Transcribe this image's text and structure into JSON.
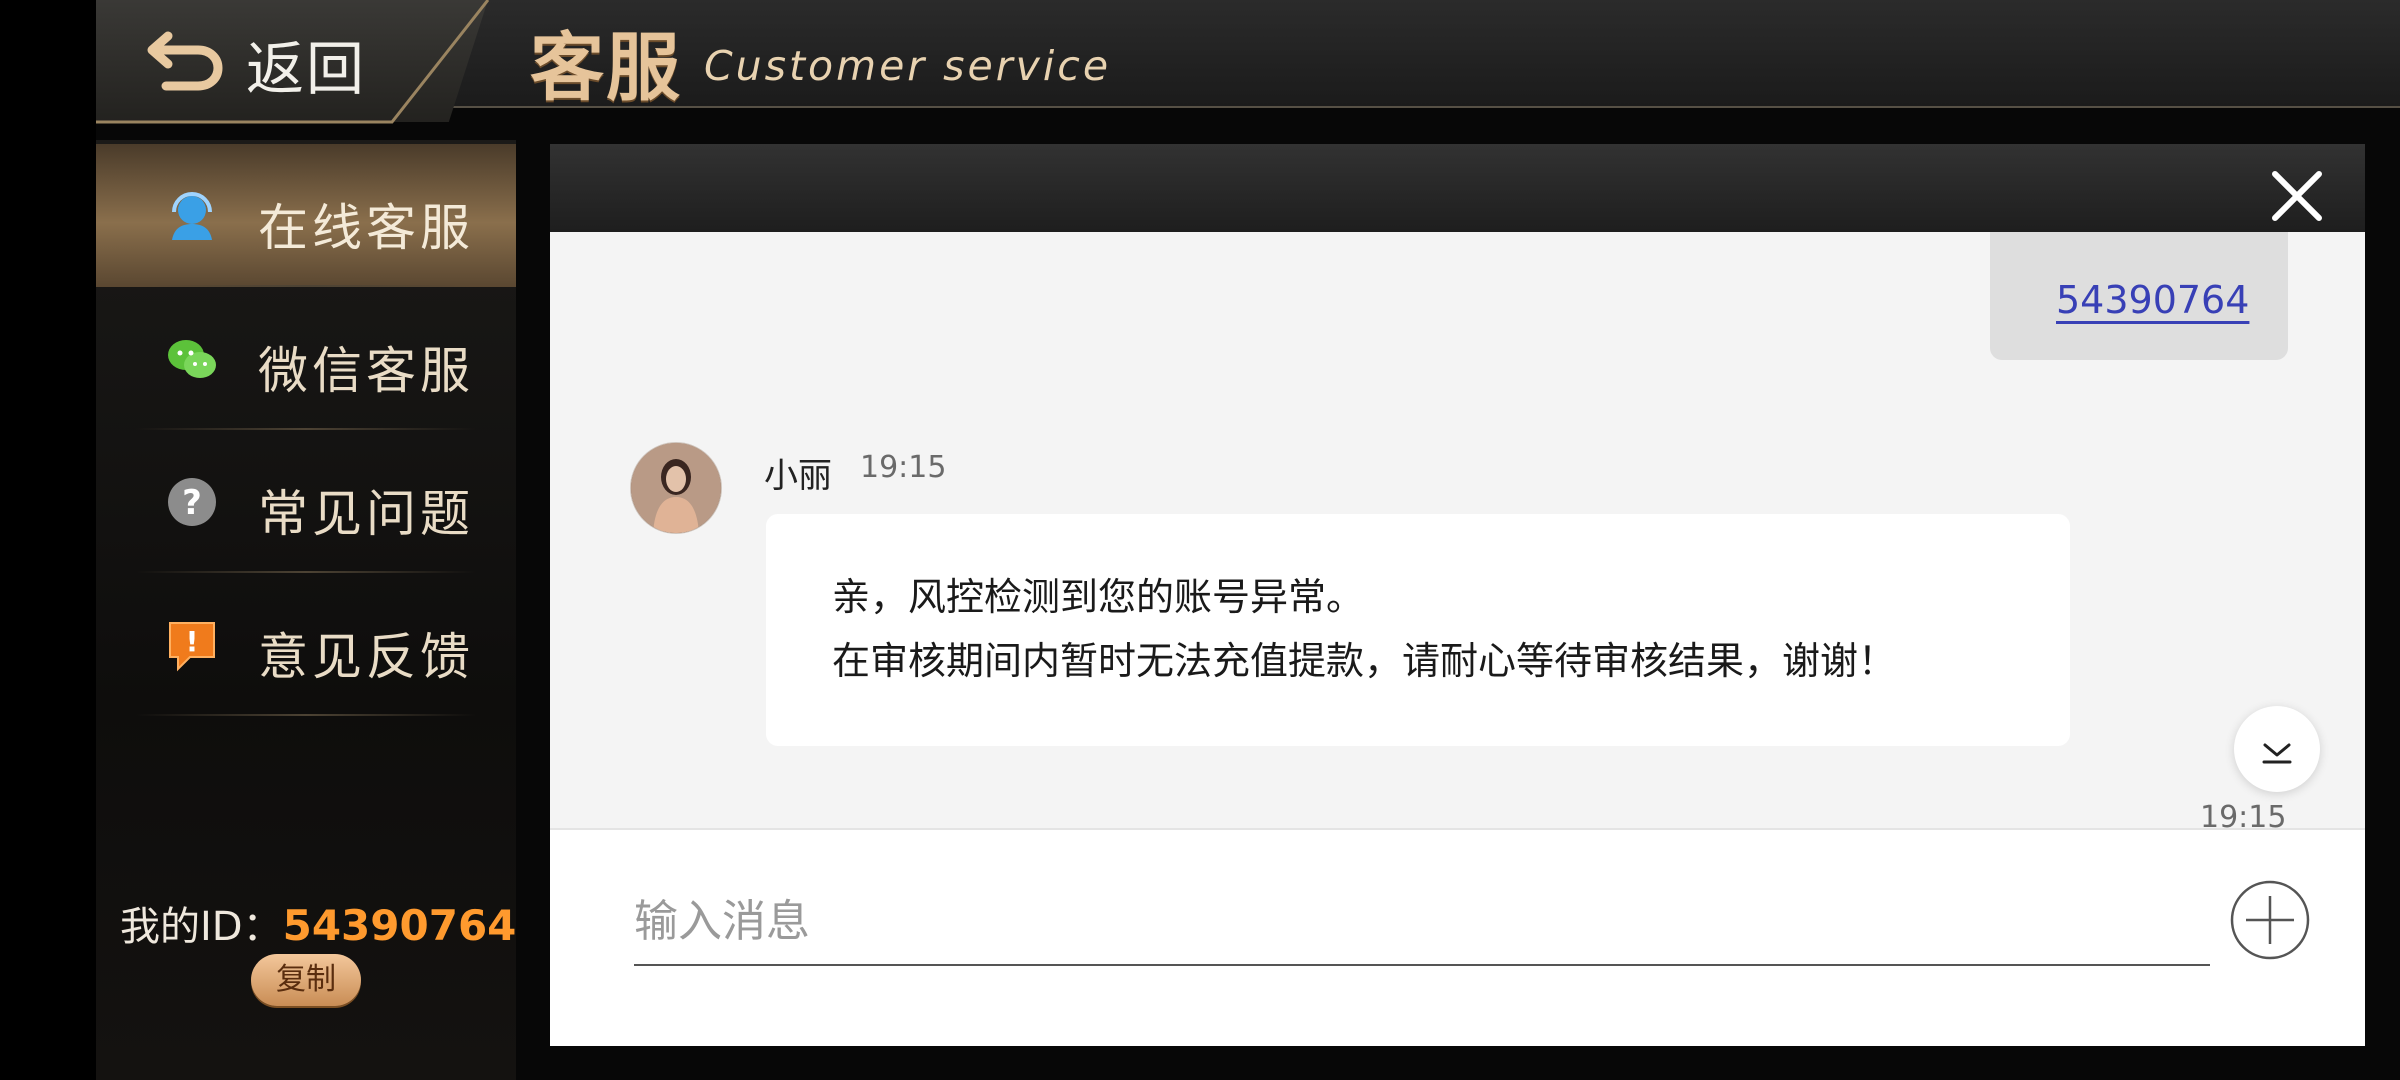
{
  "header": {
    "back_label": "返回",
    "title": "客服",
    "subtitle": "Customer service"
  },
  "sidebar": {
    "items": [
      {
        "label": "在线客服",
        "icon": "headset-icon",
        "active": true
      },
      {
        "label": "微信客服",
        "icon": "wechat-icon",
        "active": false
      },
      {
        "label": "常见问题",
        "icon": "question-icon",
        "active": false
      },
      {
        "label": "意见反馈",
        "icon": "feedback-icon",
        "active": false
      }
    ],
    "my_id_label": "我的ID：",
    "my_id_value": "54390764",
    "copy_label": "复制"
  },
  "chat": {
    "sent_message": "54390764",
    "sent_time": "19:15",
    "agent_name": "小丽",
    "agent_time": "19:15",
    "agent_message_lines": [
      "亲，风控检测到您的账号异常。",
      "在审核期间内暂时无法充值提款，请耐心等待审核结果，谢谢！"
    ]
  },
  "input": {
    "placeholder": "输入消息"
  },
  "colors": {
    "accent_gold": "#e6c49a",
    "id_orange": "#ff9a2e",
    "link_blue": "#3840b6"
  }
}
